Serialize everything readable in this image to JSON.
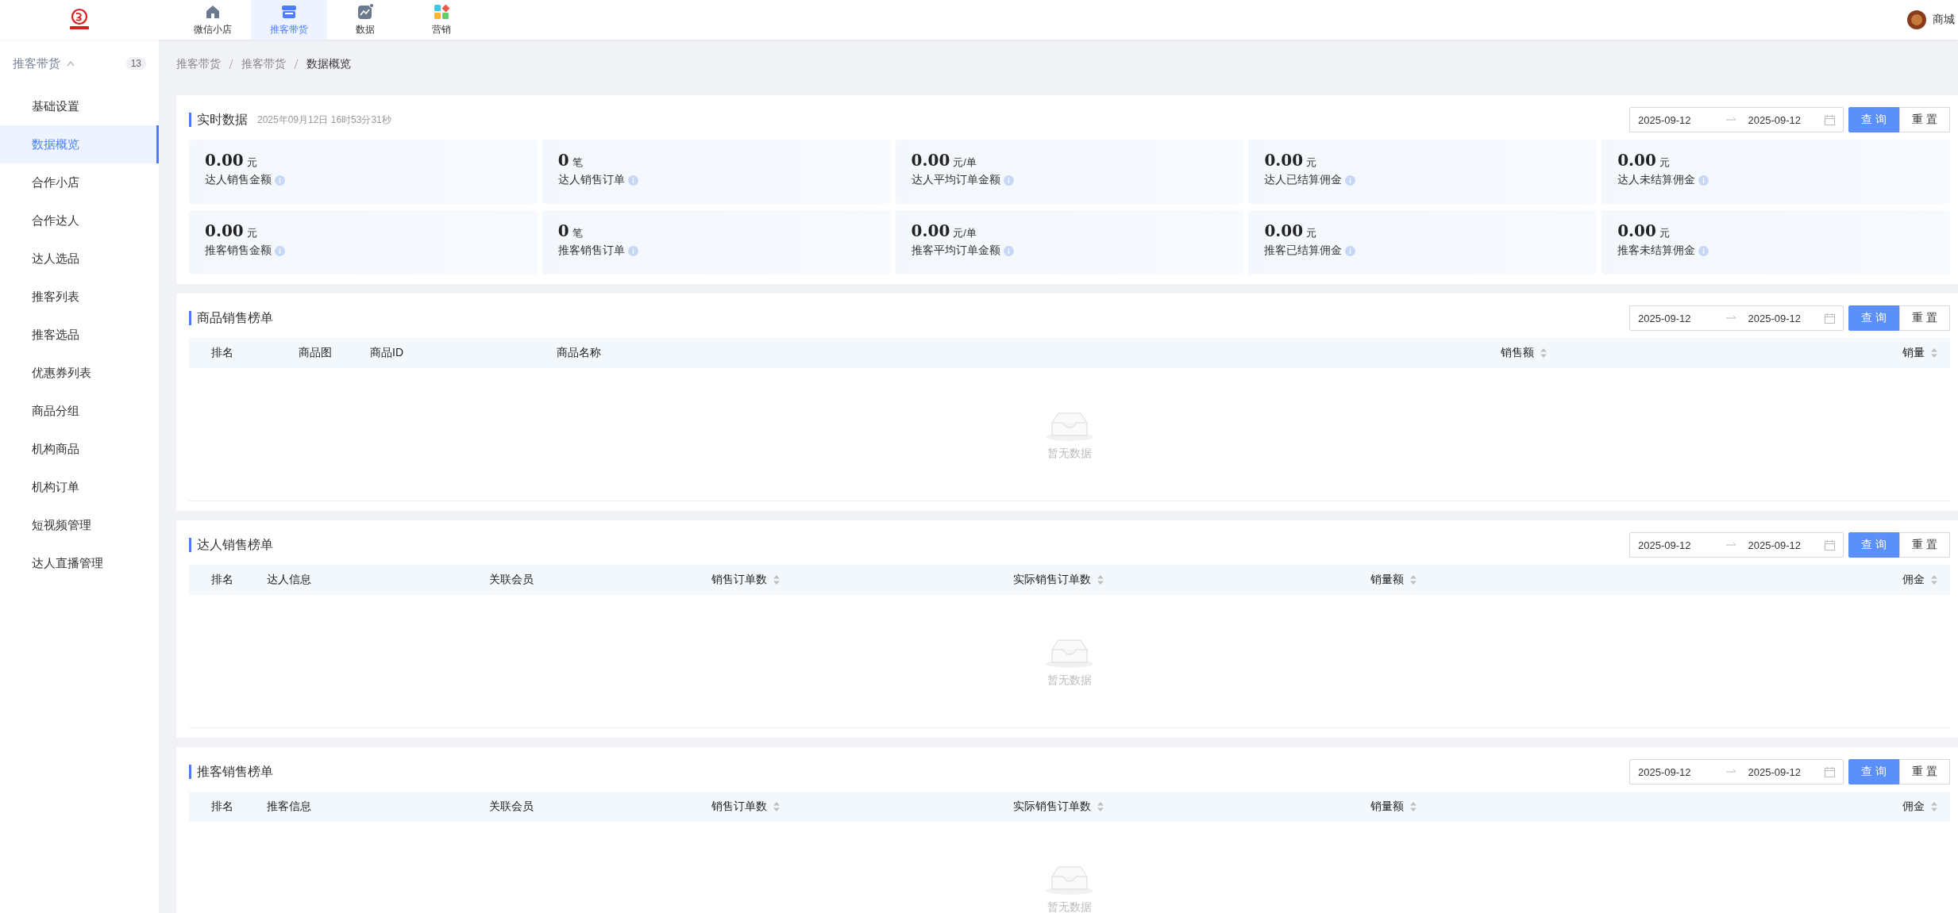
{
  "header": {
    "nav": [
      {
        "label": "微信小店",
        "selected": false,
        "kind": "home"
      },
      {
        "label": "推客带货",
        "selected": true,
        "kind": "store"
      },
      {
        "label": "数据",
        "selected": false,
        "kind": "chart"
      },
      {
        "label": "营销",
        "selected": false,
        "kind": "apps"
      }
    ],
    "user": {
      "name": "商城"
    }
  },
  "sidebar": {
    "group": {
      "label": "推客带货",
      "expanded": true,
      "count": "13"
    },
    "items": [
      {
        "label": "基础设置",
        "selected": false
      },
      {
        "label": "数据概览",
        "selected": true
      },
      {
        "label": "合作小店",
        "selected": false
      },
      {
        "label": "合作达人",
        "selected": false
      },
      {
        "label": "达人选品",
        "selected": false
      },
      {
        "label": "推客列表",
        "selected": false
      },
      {
        "label": "推客选品",
        "selected": false
      },
      {
        "label": "优惠券列表",
        "selected": false
      },
      {
        "label": "商品分组",
        "selected": false
      },
      {
        "label": "机构商品",
        "selected": false
      },
      {
        "label": "机构订单",
        "selected": false
      },
      {
        "label": "短视频管理",
        "selected": false
      },
      {
        "label": "达人直播管理",
        "selected": false
      }
    ]
  },
  "breadcrumb": [
    "推客带货",
    "推客带货",
    "数据概览"
  ],
  "realtime": {
    "title": "实时数据",
    "timestamp": "2025年09月12日 16时53分31秒",
    "date_range": {
      "start": "2025-09-12",
      "end": "2025-09-12"
    },
    "query_button": "查 询",
    "reset_button": "重 置",
    "stats": [
      {
        "value": "0.00",
        "unit": "元",
        "label": "达人销售金额"
      },
      {
        "value": "0",
        "unit": "笔",
        "label": "达人销售订单"
      },
      {
        "value": "0.00",
        "unit": "元/单",
        "label": "达人平均订单金额"
      },
      {
        "value": "0.00",
        "unit": "元",
        "label": "达人已结算佣金"
      },
      {
        "value": "0.00",
        "unit": "元",
        "label": "达人未结算佣金"
      },
      {
        "value": "0.00",
        "unit": "元",
        "label": "推客销售金额"
      },
      {
        "value": "0",
        "unit": "笔",
        "label": "推客销售订单"
      },
      {
        "value": "0.00",
        "unit": "元/单",
        "label": "推客平均订单金额"
      },
      {
        "value": "0.00",
        "unit": "元",
        "label": "推客已结算佣金"
      },
      {
        "value": "0.00",
        "unit": "元",
        "label": "推客未结算佣金"
      }
    ]
  },
  "rankings": [
    {
      "title": "商品销售榜单",
      "date_range": {
        "start": "2025-09-12",
        "end": "2025-09-12"
      },
      "query_button": "查 询",
      "reset_button": "重 置",
      "columns": [
        {
          "label": "排名",
          "sortable": false
        },
        {
          "label": "商品图",
          "sortable": false
        },
        {
          "label": "商品ID",
          "sortable": false
        },
        {
          "label": "商品名称",
          "sortable": false
        },
        {
          "label": "销售额",
          "sortable": true
        },
        {
          "label": "销量",
          "sortable": true
        }
      ],
      "empty_text": "暂无数据"
    },
    {
      "title": "达人销售榜单",
      "date_range": {
        "start": "2025-09-12",
        "end": "2025-09-12"
      },
      "query_button": "查 询",
      "reset_button": "重 置",
      "columns": [
        {
          "label": "排名",
          "sortable": false
        },
        {
          "label": "达人信息",
          "sortable": false
        },
        {
          "label": "关联会员",
          "sortable": false
        },
        {
          "label": "销售订单数",
          "sortable": true
        },
        {
          "label": "实际销售订单数",
          "sortable": true
        },
        {
          "label": "销量额",
          "sortable": true
        },
        {
          "label": "佣金",
          "sortable": true
        }
      ],
      "empty_text": "暂无数据"
    },
    {
      "title": "推客销售榜单",
      "date_range": {
        "start": "2025-09-12",
        "end": "2025-09-12"
      },
      "query_button": "查 询",
      "reset_button": "重 置",
      "columns": [
        {
          "label": "排名",
          "sortable": false
        },
        {
          "label": "推客信息",
          "sortable": false
        },
        {
          "label": "关联会员",
          "sortable": false
        },
        {
          "label": "销售订单数",
          "sortable": true
        },
        {
          "label": "实际销售订单数",
          "sortable": true
        },
        {
          "label": "销量额",
          "sortable": true
        },
        {
          "label": "佣金",
          "sortable": true
        }
      ],
      "empty_text": "暂无数据"
    }
  ]
}
